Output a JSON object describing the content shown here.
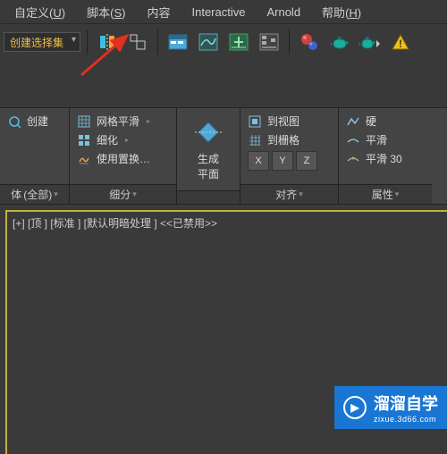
{
  "menubar": {
    "items": [
      {
        "label": "自定义",
        "key": "U"
      },
      {
        "label": "脚本",
        "key": "S"
      },
      {
        "label": "内容",
        "key": ""
      },
      {
        "label": "Interactive",
        "key": ""
      },
      {
        "label": "Arnold",
        "key": ""
      },
      {
        "label": "帮助",
        "key": "H"
      }
    ]
  },
  "maintool": {
    "selection_set": "创建选择集",
    "icons": [
      "mirror",
      "align",
      "layers",
      "curve-editor",
      "dope",
      "schematic",
      "separator",
      "material",
      "render-teapot",
      "render-teapot-arrow",
      "warning"
    ]
  },
  "ribbon": {
    "panel_create": {
      "title_prefix": "体",
      "title": "(全部)",
      "create_label": "创建"
    },
    "panel_subdiv": {
      "title": "细分",
      "items": [
        {
          "label": "网格平滑",
          "icon": "mesh-smooth"
        },
        {
          "label": "细化",
          "icon": "tessellate"
        },
        {
          "label": "使用置换…",
          "icon": "displace"
        }
      ]
    },
    "panel_plane": {
      "title": "",
      "btn": "生成\n平面"
    },
    "panel_align": {
      "title": "对齐",
      "items": [
        {
          "label": "到视图",
          "icon": "align-view"
        },
        {
          "label": "到栅格",
          "icon": "align-grid"
        }
      ],
      "xyz": [
        "X",
        "Y",
        "Z"
      ]
    },
    "panel_attr": {
      "title": "属性",
      "items": [
        {
          "label": "硬",
          "icon": "hard"
        },
        {
          "label": "平滑",
          "icon": "smooth"
        },
        {
          "label": "平滑 30",
          "icon": "smooth30"
        }
      ]
    }
  },
  "viewport": {
    "label": "[+] [顶 ] [标准 ] [默认明暗处理 ]  <<已禁用>>"
  },
  "watermark": {
    "title": "溜溜自学",
    "url": "zixue.3d66.com"
  }
}
